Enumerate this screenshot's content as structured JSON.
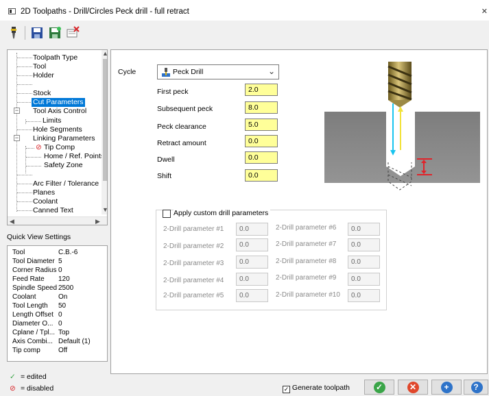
{
  "window": {
    "title": "2D Toolpaths - Drill/Circles Peck drill - full retract"
  },
  "colors": {
    "selected": "#0078d7",
    "field_bg": "#ffff99",
    "ok": "#3aa548",
    "cancel": "#e0472b",
    "add": "#2e73c9",
    "help": "#2e73c9"
  },
  "toolbar": {
    "icons": [
      "drill-tool-icon",
      "save-icon",
      "save-all-icon",
      "remove-icon"
    ]
  },
  "tree": {
    "items": [
      {
        "label": "Toolpath Type"
      },
      {
        "label": "Tool"
      },
      {
        "label": "Holder"
      },
      {
        "label": ""
      },
      {
        "label": "Stock"
      },
      {
        "label": "Cut Parameters"
      },
      {
        "label": "Tool Axis Control"
      },
      {
        "label": "Limits"
      },
      {
        "label": "Hole Segments"
      },
      {
        "label": "Linking Parameters"
      },
      {
        "label": "Tip Comp"
      },
      {
        "label": "Home / Ref. Points"
      },
      {
        "label": "Safety Zone"
      },
      {
        "label": ""
      },
      {
        "label": "Arc Filter / Tolerance"
      },
      {
        "label": "Planes"
      },
      {
        "label": "Coolant"
      },
      {
        "label": "Canned Text"
      }
    ]
  },
  "quick_view": {
    "title": "Quick View Settings",
    "rows": [
      {
        "key": "Tool",
        "value": "C.B.-6"
      },
      {
        "key": "Tool Diameter",
        "value": "5"
      },
      {
        "key": "Corner Radius",
        "value": "0"
      },
      {
        "key": "Feed Rate",
        "value": "120"
      },
      {
        "key": "Spindle Speed",
        "value": "2500"
      },
      {
        "key": "Coolant",
        "value": "On"
      },
      {
        "key": "Tool Length",
        "value": "50"
      },
      {
        "key": "Length Offset",
        "value": "0"
      },
      {
        "key": "Diameter O...",
        "value": "0"
      },
      {
        "key": "Cplane / Tpl...",
        "value": "Top"
      },
      {
        "key": "Axis Combi...",
        "value": "Default (1)"
      },
      {
        "key": "Tip comp",
        "value": "Off"
      }
    ]
  },
  "legend": {
    "edited_symbol": "✓",
    "edited": "= edited",
    "disabled_symbol": "⊘",
    "disabled": "= disabled"
  },
  "cut": {
    "cycle_label": "Cycle",
    "cycle_value": "Peck Drill",
    "fields": [
      {
        "label": "First peck",
        "value": "2.0"
      },
      {
        "label": "Subsequent peck",
        "value": "8.0"
      },
      {
        "label": "Peck clearance",
        "value": "5.0"
      },
      {
        "label": "Retract amount",
        "value": "0.0"
      },
      {
        "label": "Dwell",
        "value": "0.0"
      },
      {
        "label": "Shift",
        "value": "0.0"
      }
    ]
  },
  "custom": {
    "checkbox_label": "Apply custom drill parameters",
    "params": [
      {
        "label": "2-Drill parameter #1",
        "value": "0.0"
      },
      {
        "label": "2-Drill parameter #2",
        "value": "0.0"
      },
      {
        "label": "2-Drill parameter #3",
        "value": "0.0"
      },
      {
        "label": "2-Drill parameter #4",
        "value": "0.0"
      },
      {
        "label": "2-Drill parameter #5",
        "value": "0.0"
      },
      {
        "label": "2-Drill parameter #6",
        "value": "0.0"
      },
      {
        "label": "2-Drill parameter #7",
        "value": "0.0"
      },
      {
        "label": "2-Drill parameter #8",
        "value": "0.0"
      },
      {
        "label": "2-Drill parameter #9",
        "value": "0.0"
      },
      {
        "label": "2-Drill parameter #10",
        "value": "0.0"
      }
    ]
  },
  "footer": {
    "generate_label": "Generate toolpath",
    "buttons": [
      {
        "name": "ok-button",
        "icon": "check-icon",
        "glyph": "✓"
      },
      {
        "name": "cancel-button",
        "icon": "x-icon",
        "glyph": "✕"
      },
      {
        "name": "add-button",
        "icon": "plus-icon",
        "glyph": "+"
      },
      {
        "name": "help-button",
        "icon": "question-icon",
        "glyph": "?"
      }
    ]
  }
}
